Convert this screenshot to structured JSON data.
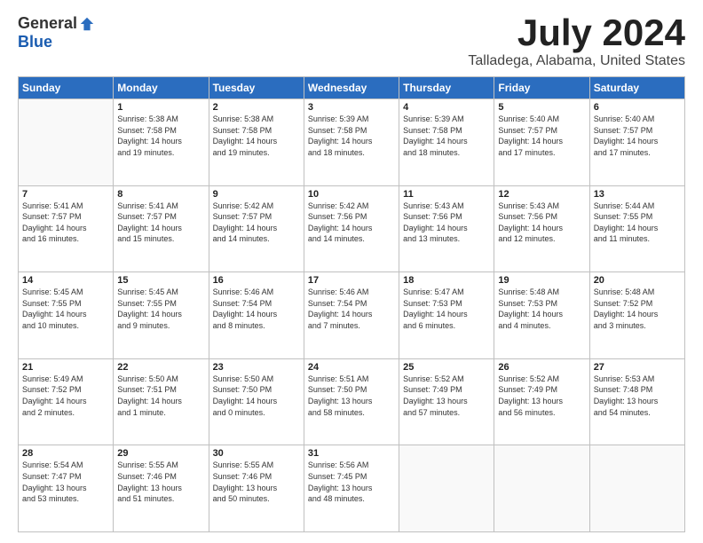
{
  "logo": {
    "general": "General",
    "blue": "Blue"
  },
  "title": "July 2024",
  "location": "Talladega, Alabama, United States",
  "days_of_week": [
    "Sunday",
    "Monday",
    "Tuesday",
    "Wednesday",
    "Thursday",
    "Friday",
    "Saturday"
  ],
  "weeks": [
    [
      {
        "day": "",
        "info": ""
      },
      {
        "day": "1",
        "info": "Sunrise: 5:38 AM\nSunset: 7:58 PM\nDaylight: 14 hours\nand 19 minutes."
      },
      {
        "day": "2",
        "info": "Sunrise: 5:38 AM\nSunset: 7:58 PM\nDaylight: 14 hours\nand 19 minutes."
      },
      {
        "day": "3",
        "info": "Sunrise: 5:39 AM\nSunset: 7:58 PM\nDaylight: 14 hours\nand 18 minutes."
      },
      {
        "day": "4",
        "info": "Sunrise: 5:39 AM\nSunset: 7:58 PM\nDaylight: 14 hours\nand 18 minutes."
      },
      {
        "day": "5",
        "info": "Sunrise: 5:40 AM\nSunset: 7:57 PM\nDaylight: 14 hours\nand 17 minutes."
      },
      {
        "day": "6",
        "info": "Sunrise: 5:40 AM\nSunset: 7:57 PM\nDaylight: 14 hours\nand 17 minutes."
      }
    ],
    [
      {
        "day": "7",
        "info": "Sunrise: 5:41 AM\nSunset: 7:57 PM\nDaylight: 14 hours\nand 16 minutes."
      },
      {
        "day": "8",
        "info": "Sunrise: 5:41 AM\nSunset: 7:57 PM\nDaylight: 14 hours\nand 15 minutes."
      },
      {
        "day": "9",
        "info": "Sunrise: 5:42 AM\nSunset: 7:57 PM\nDaylight: 14 hours\nand 14 minutes."
      },
      {
        "day": "10",
        "info": "Sunrise: 5:42 AM\nSunset: 7:56 PM\nDaylight: 14 hours\nand 14 minutes."
      },
      {
        "day": "11",
        "info": "Sunrise: 5:43 AM\nSunset: 7:56 PM\nDaylight: 14 hours\nand 13 minutes."
      },
      {
        "day": "12",
        "info": "Sunrise: 5:43 AM\nSunset: 7:56 PM\nDaylight: 14 hours\nand 12 minutes."
      },
      {
        "day": "13",
        "info": "Sunrise: 5:44 AM\nSunset: 7:55 PM\nDaylight: 14 hours\nand 11 minutes."
      }
    ],
    [
      {
        "day": "14",
        "info": "Sunrise: 5:45 AM\nSunset: 7:55 PM\nDaylight: 14 hours\nand 10 minutes."
      },
      {
        "day": "15",
        "info": "Sunrise: 5:45 AM\nSunset: 7:55 PM\nDaylight: 14 hours\nand 9 minutes."
      },
      {
        "day": "16",
        "info": "Sunrise: 5:46 AM\nSunset: 7:54 PM\nDaylight: 14 hours\nand 8 minutes."
      },
      {
        "day": "17",
        "info": "Sunrise: 5:46 AM\nSunset: 7:54 PM\nDaylight: 14 hours\nand 7 minutes."
      },
      {
        "day": "18",
        "info": "Sunrise: 5:47 AM\nSunset: 7:53 PM\nDaylight: 14 hours\nand 6 minutes."
      },
      {
        "day": "19",
        "info": "Sunrise: 5:48 AM\nSunset: 7:53 PM\nDaylight: 14 hours\nand 4 minutes."
      },
      {
        "day": "20",
        "info": "Sunrise: 5:48 AM\nSunset: 7:52 PM\nDaylight: 14 hours\nand 3 minutes."
      }
    ],
    [
      {
        "day": "21",
        "info": "Sunrise: 5:49 AM\nSunset: 7:52 PM\nDaylight: 14 hours\nand 2 minutes."
      },
      {
        "day": "22",
        "info": "Sunrise: 5:50 AM\nSunset: 7:51 PM\nDaylight: 14 hours\nand 1 minute."
      },
      {
        "day": "23",
        "info": "Sunrise: 5:50 AM\nSunset: 7:50 PM\nDaylight: 14 hours\nand 0 minutes."
      },
      {
        "day": "24",
        "info": "Sunrise: 5:51 AM\nSunset: 7:50 PM\nDaylight: 13 hours\nand 58 minutes."
      },
      {
        "day": "25",
        "info": "Sunrise: 5:52 AM\nSunset: 7:49 PM\nDaylight: 13 hours\nand 57 minutes."
      },
      {
        "day": "26",
        "info": "Sunrise: 5:52 AM\nSunset: 7:49 PM\nDaylight: 13 hours\nand 56 minutes."
      },
      {
        "day": "27",
        "info": "Sunrise: 5:53 AM\nSunset: 7:48 PM\nDaylight: 13 hours\nand 54 minutes."
      }
    ],
    [
      {
        "day": "28",
        "info": "Sunrise: 5:54 AM\nSunset: 7:47 PM\nDaylight: 13 hours\nand 53 minutes."
      },
      {
        "day": "29",
        "info": "Sunrise: 5:55 AM\nSunset: 7:46 PM\nDaylight: 13 hours\nand 51 minutes."
      },
      {
        "day": "30",
        "info": "Sunrise: 5:55 AM\nSunset: 7:46 PM\nDaylight: 13 hours\nand 50 minutes."
      },
      {
        "day": "31",
        "info": "Sunrise: 5:56 AM\nSunset: 7:45 PM\nDaylight: 13 hours\nand 48 minutes."
      },
      {
        "day": "",
        "info": ""
      },
      {
        "day": "",
        "info": ""
      },
      {
        "day": "",
        "info": ""
      }
    ]
  ]
}
